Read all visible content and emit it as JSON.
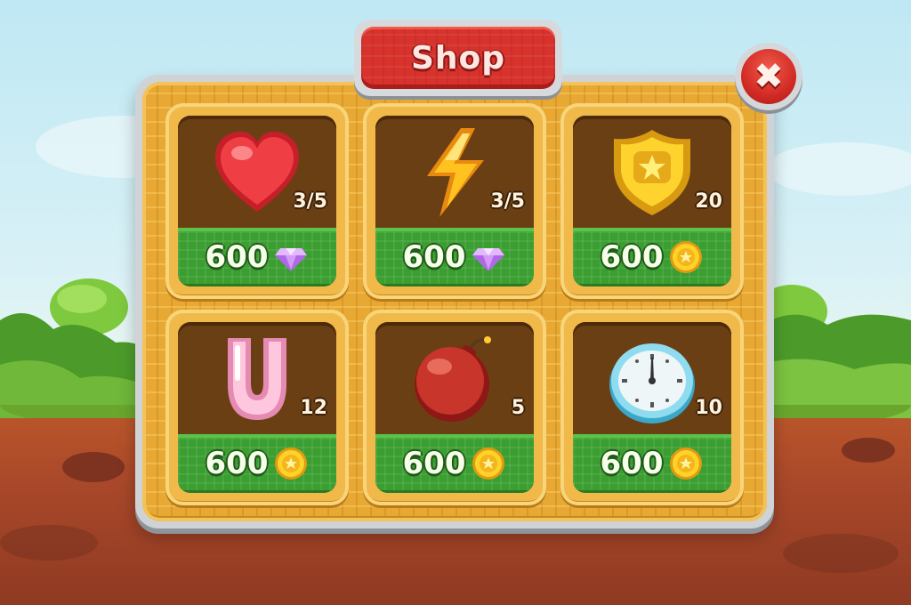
{
  "title": "Shop",
  "close_label": "✖",
  "items": [
    {
      "name": "heart",
      "icon": "heart-icon",
      "quantity": "3/5",
      "price": "600",
      "currency": "diamond-icon"
    },
    {
      "name": "energy",
      "icon": "lightning-icon",
      "quantity": "3/5",
      "price": "600",
      "currency": "diamond-icon"
    },
    {
      "name": "shield",
      "icon": "shield-star-icon",
      "quantity": "20",
      "price": "600",
      "currency": "coin-icon"
    },
    {
      "name": "magnet",
      "icon": "magnet-icon",
      "quantity": "12",
      "price": "600",
      "currency": "coin-icon"
    },
    {
      "name": "bomb",
      "icon": "bomb-icon",
      "quantity": "5",
      "price": "600",
      "currency": "coin-icon"
    },
    {
      "name": "clock",
      "icon": "clock-icon",
      "quantity": "10",
      "price": "600",
      "currency": "coin-icon"
    }
  ],
  "colors": {
    "banner": "#d8322c",
    "board": "#e8a934",
    "slot_inner": "#6b3f14",
    "price_bar": "#3b9e31"
  }
}
